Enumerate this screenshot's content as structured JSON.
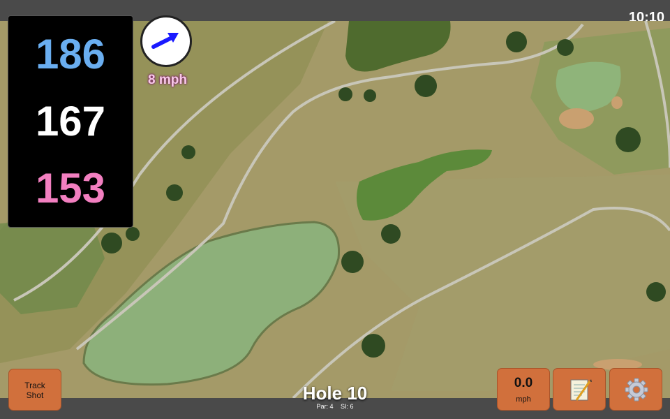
{
  "status": {
    "time": "10:10"
  },
  "distances": {
    "back": "186",
    "middle": "167",
    "front": "153"
  },
  "wind": {
    "speed_label": "8 mph",
    "arrow_icon": "wind-arrow-icon"
  },
  "hole": {
    "title": "Hole 10",
    "par": "Par: 4",
    "stroke_index": "SI: 6"
  },
  "buttons": {
    "track_shot": {
      "line1": "Track",
      "line2": "Shot"
    },
    "wind_speed": {
      "value": "0.0",
      "unit": "mph"
    },
    "notes": {
      "icon": "notepad-icon"
    },
    "settings": {
      "icon": "gear-icon"
    }
  },
  "colors": {
    "accent_button": "#d1703c",
    "back_distance": "#6aaef0",
    "middle_distance": "#ffffff",
    "front_distance": "#f27fc0",
    "wind_arrow": "#1a1aff"
  }
}
